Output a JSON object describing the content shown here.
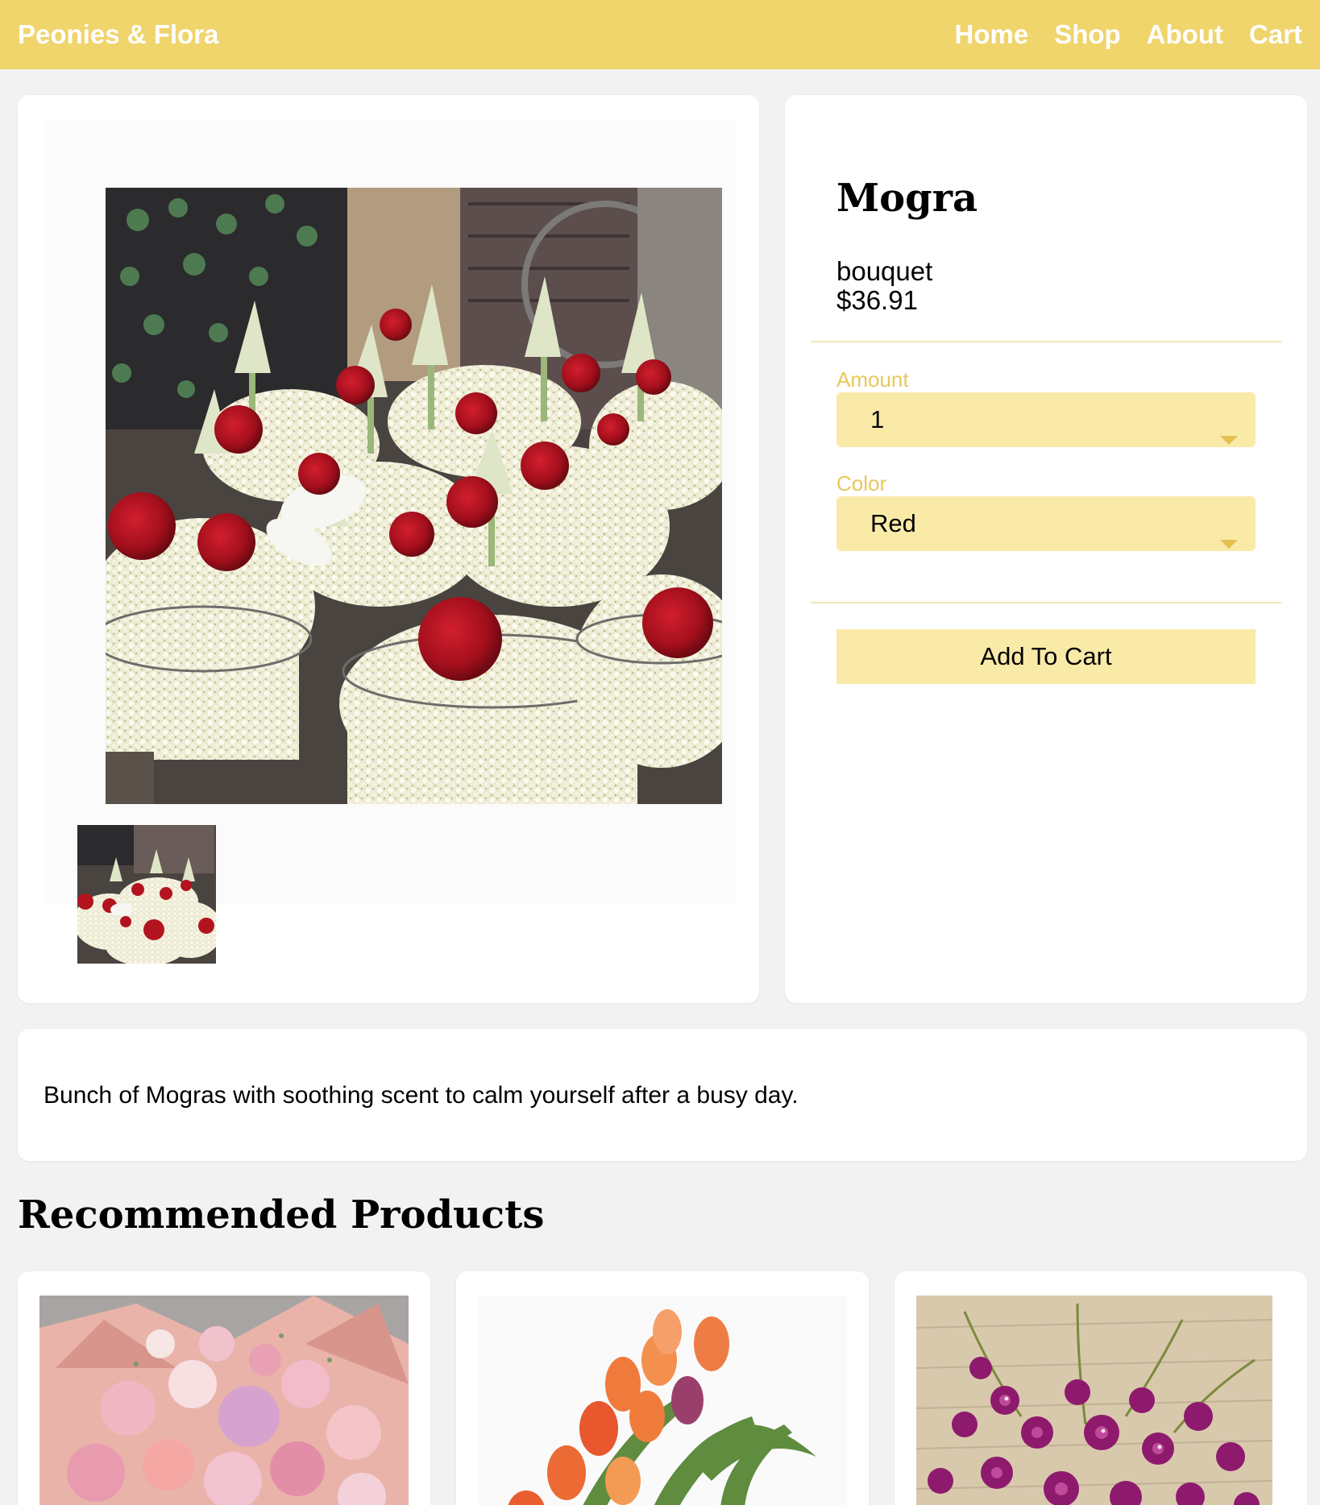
{
  "header": {
    "brand": "Peonies & Flora",
    "nav": [
      "Home",
      "Shop",
      "About",
      "Cart"
    ]
  },
  "product": {
    "name": "Mogra",
    "type": "bouquet",
    "price": "$36.91",
    "amount_label": "Amount",
    "amount_value": "1",
    "color_label": "Color",
    "color_value": "Red",
    "add_to_cart": "Add To Cart",
    "description": "Bunch of Mogras with soothing scent to calm yourself after a busy day."
  },
  "recommended": {
    "title": "Recommended Products",
    "items": [
      {
        "image": "pink-roses-bouquet"
      },
      {
        "image": "orange-tulips"
      },
      {
        "image": "purple-orchids"
      }
    ]
  },
  "colors": {
    "accent": "#f0d46c",
    "field_bg": "#faeaa8",
    "label": "#e8c85a",
    "page_bg": "#f2f2f2"
  }
}
